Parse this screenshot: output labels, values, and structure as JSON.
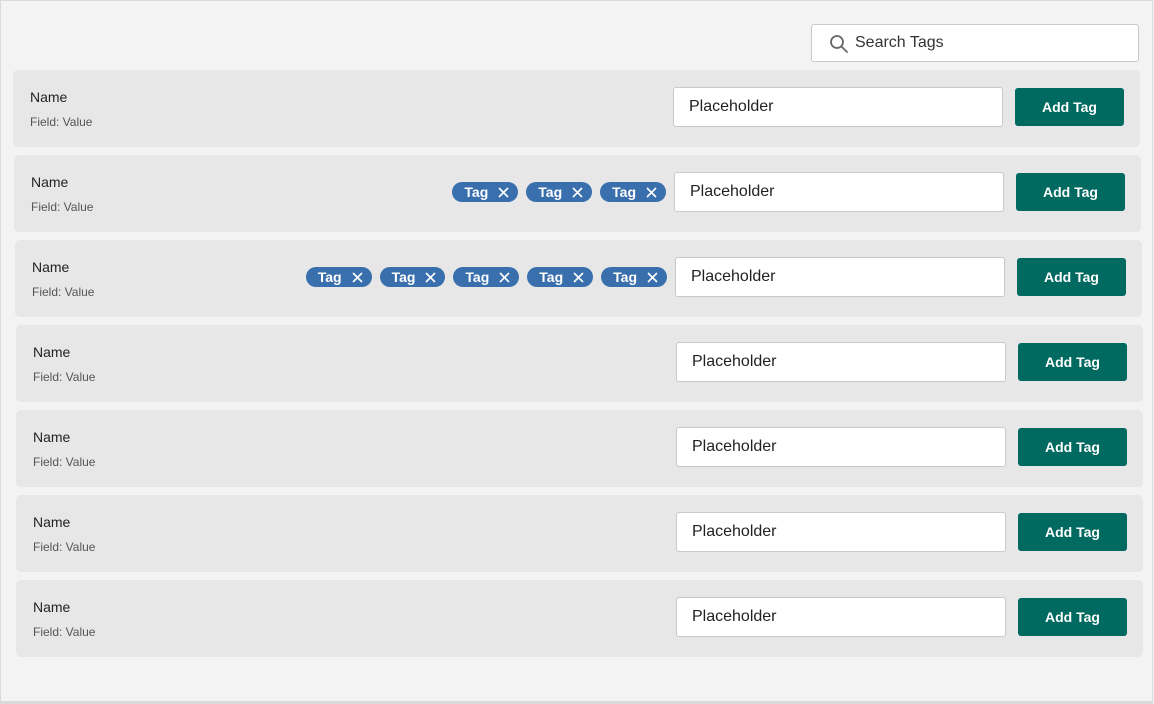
{
  "search": {
    "placeholder": "Search Tags",
    "icon": "search-icon"
  },
  "colors": {
    "tag_bg": "#3a6fad",
    "button_bg": "#006960",
    "row_bg": "#e7e7e7",
    "page_bg": "#f3f3f3"
  },
  "rows": [
    {
      "name": "Name",
      "field": "Field: Value",
      "tags": [],
      "input_placeholder": "Placeholder",
      "button_label": "Add Tag"
    },
    {
      "name": "Name",
      "field": "Field: Value",
      "tags": [
        "Tag",
        "Tag",
        "Tag"
      ],
      "input_placeholder": "Placeholder",
      "button_label": "Add Tag"
    },
    {
      "name": "Name",
      "field": "Field: Value",
      "tags": [
        "Tag",
        "Tag",
        "Tag",
        "Tag",
        "Tag"
      ],
      "input_placeholder": "Placeholder",
      "button_label": "Add Tag"
    },
    {
      "name": "Name",
      "field": "Field: Value",
      "tags": [],
      "input_placeholder": "Placeholder",
      "button_label": "Add Tag"
    },
    {
      "name": "Name",
      "field": "Field: Value",
      "tags": [],
      "input_placeholder": "Placeholder",
      "button_label": "Add Tag"
    },
    {
      "name": "Name",
      "field": "Field: Value",
      "tags": [],
      "input_placeholder": "Placeholder",
      "button_label": "Add Tag"
    },
    {
      "name": "Name",
      "field": "Field: Value",
      "tags": [],
      "input_placeholder": "Placeholder",
      "button_label": "Add Tag"
    }
  ]
}
